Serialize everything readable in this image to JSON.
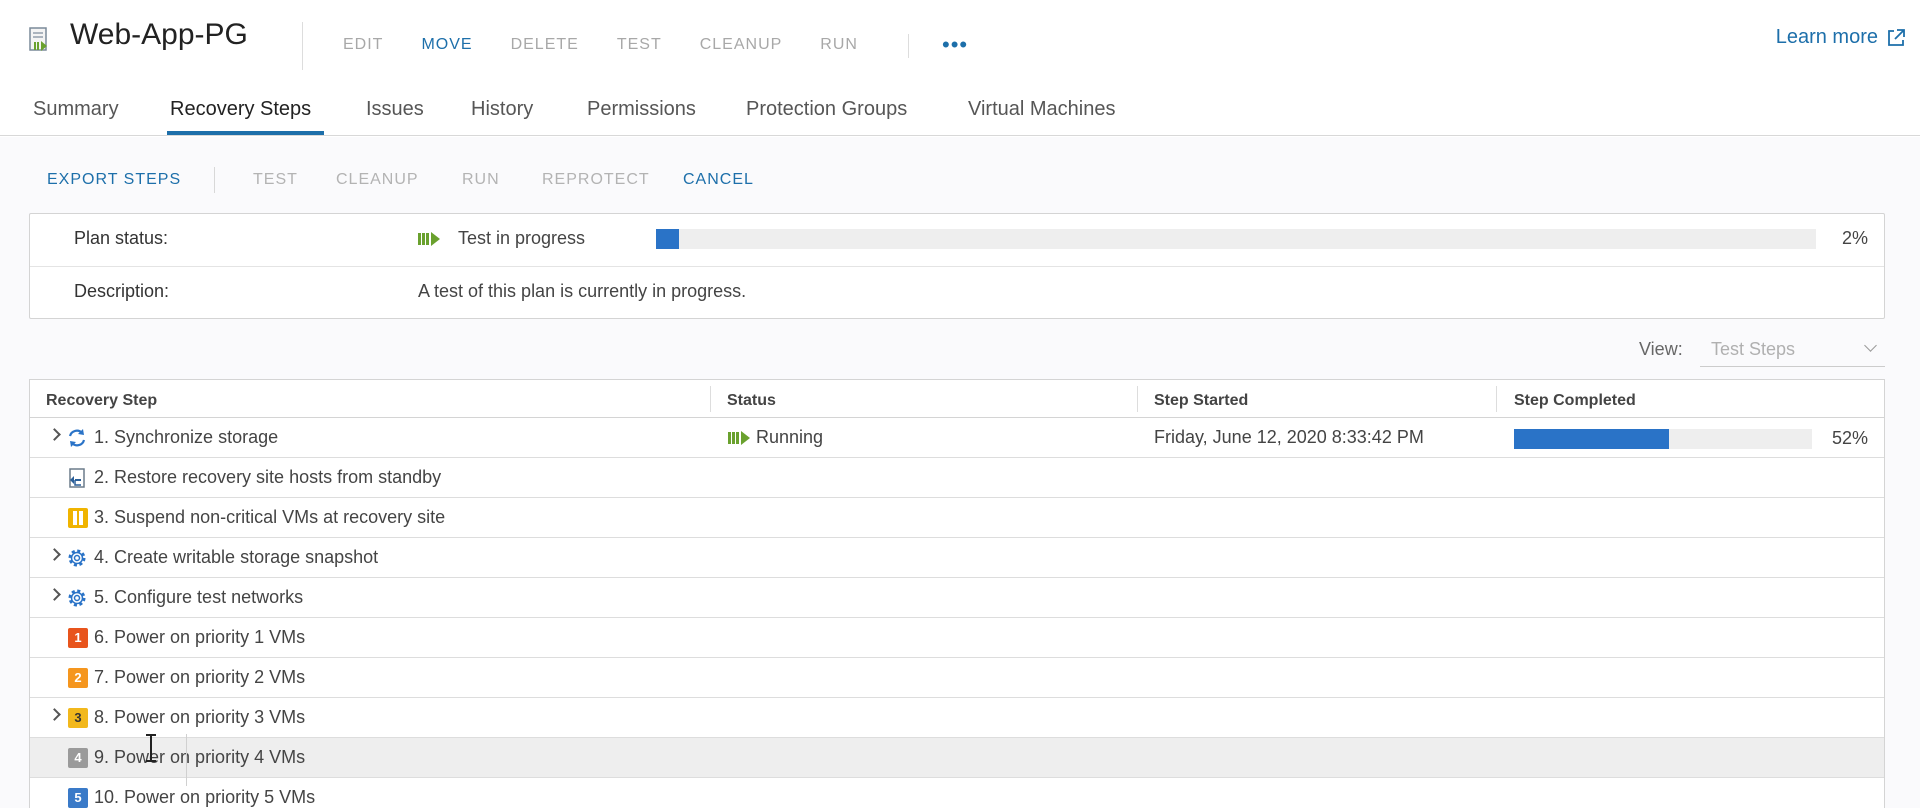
{
  "header": {
    "title": "Web-App-PG",
    "actions": [
      "EDIT",
      "MOVE",
      "DELETE",
      "TEST",
      "CLEANUP",
      "RUN"
    ],
    "active_action": "MOVE",
    "more_label": "•••",
    "learn_more": "Learn more"
  },
  "tabs": [
    "Summary",
    "Recovery Steps",
    "Issues",
    "History",
    "Permissions",
    "Protection Groups",
    "Virtual Machines"
  ],
  "active_tab": "Recovery Steps",
  "toolbar": {
    "export": "EXPORT STEPS",
    "test": "TEST",
    "cleanup": "CLEANUP",
    "run": "RUN",
    "reprotect": "REPROTECT",
    "cancel": "CANCEL"
  },
  "plan": {
    "status_label": "Plan status:",
    "status_value": "Test in progress",
    "progress_pct": 2,
    "progress_text": "2%",
    "description_label": "Description:",
    "description_value": "A test of this plan is currently in progress."
  },
  "view": {
    "label": "View:",
    "selected": "Test Steps"
  },
  "grid": {
    "columns": [
      "Recovery Step",
      "Status",
      "Step Started",
      "Step Completed"
    ],
    "rows": [
      {
        "step": "1. Synchronize storage",
        "icon": "sync-icon",
        "expandable": true,
        "status": "Running",
        "started": "Friday, June 12, 2020 8:33:42 PM",
        "completed_pct": 52,
        "completed_text": "52%"
      },
      {
        "step": "2. Restore recovery site hosts from standby",
        "icon": "host-restore-icon",
        "expandable": false
      },
      {
        "step": "3. Suspend non-critical VMs at recovery site",
        "icon": "pause-icon",
        "expandable": false
      },
      {
        "step": "4. Create writable storage snapshot",
        "icon": "gear-icon",
        "expandable": true
      },
      {
        "step": "5. Configure test networks",
        "icon": "gear-icon",
        "expandable": true
      },
      {
        "step": "6. Power on priority 1 VMs",
        "icon": "priority-1-icon",
        "badge": "1",
        "badge_color": "#e8541c",
        "expandable": false
      },
      {
        "step": "7. Power on priority 2 VMs",
        "icon": "priority-2-icon",
        "badge": "2",
        "badge_color": "#f5961e",
        "expandable": false
      },
      {
        "step": "8. Power on priority 3 VMs",
        "icon": "priority-3-icon",
        "badge": "3",
        "badge_color": "#f2b81c",
        "expandable": true
      },
      {
        "step": "9. Power on priority 4 VMs",
        "icon": "priority-4-icon",
        "badge": "4",
        "badge_color": "#9a9a9a",
        "expandable": false
      },
      {
        "step": "10. Power on priority 5 VMs",
        "icon": "priority-5-icon",
        "badge": "5",
        "badge_color": "#3a7ac8",
        "expandable": false
      }
    ]
  },
  "colors": {
    "accent": "#1d6faa",
    "progress": "#2a73c7",
    "running": "#6aa12e"
  }
}
